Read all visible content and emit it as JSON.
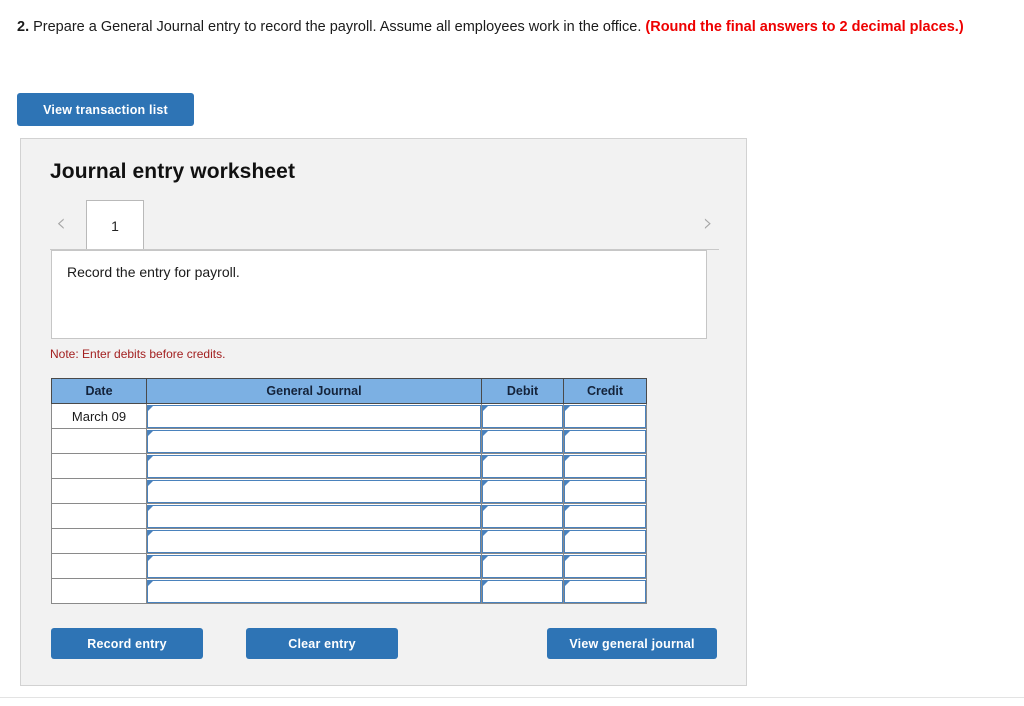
{
  "prompt": {
    "number": "2.",
    "text": " Prepare a General Journal entry to record the payroll. Assume all employees work in the office. ",
    "emphasis": "(Round the final answers to 2 decimal places.)"
  },
  "toolbar": {
    "view_transaction_list": "View transaction list"
  },
  "worksheet": {
    "title": "Journal entry worksheet",
    "prev_icon": "‹",
    "next_icon": "›",
    "tabs": [
      {
        "label": "1",
        "active": true
      }
    ],
    "instruction": "Record the entry for payroll.",
    "note": "Note: Enter debits before credits."
  },
  "table": {
    "headers": [
      "Date",
      "General Journal",
      "Debit",
      "Credit"
    ],
    "rows": [
      {
        "date": "March 09",
        "general_journal": "",
        "debit": "",
        "credit": ""
      },
      {
        "date": "",
        "general_journal": "",
        "debit": "",
        "credit": ""
      },
      {
        "date": "",
        "general_journal": "",
        "debit": "",
        "credit": ""
      },
      {
        "date": "",
        "general_journal": "",
        "debit": "",
        "credit": ""
      },
      {
        "date": "",
        "general_journal": "",
        "debit": "",
        "credit": ""
      },
      {
        "date": "",
        "general_journal": "",
        "debit": "",
        "credit": ""
      },
      {
        "date": "",
        "general_journal": "",
        "debit": "",
        "credit": ""
      },
      {
        "date": "",
        "general_journal": "",
        "debit": "",
        "credit": ""
      }
    ]
  },
  "footer": {
    "record_entry": "Record entry",
    "clear_entry": "Clear entry",
    "view_general_journal": "View general journal"
  },
  "colors": {
    "button_blue": "#2e74b5",
    "header_blue": "#7cb0e3",
    "input_border_blue": "#4a82bd",
    "note_red": "#a32020",
    "emphasis_red": "#ee0000",
    "panel_gray": "#f2f2f2"
  }
}
